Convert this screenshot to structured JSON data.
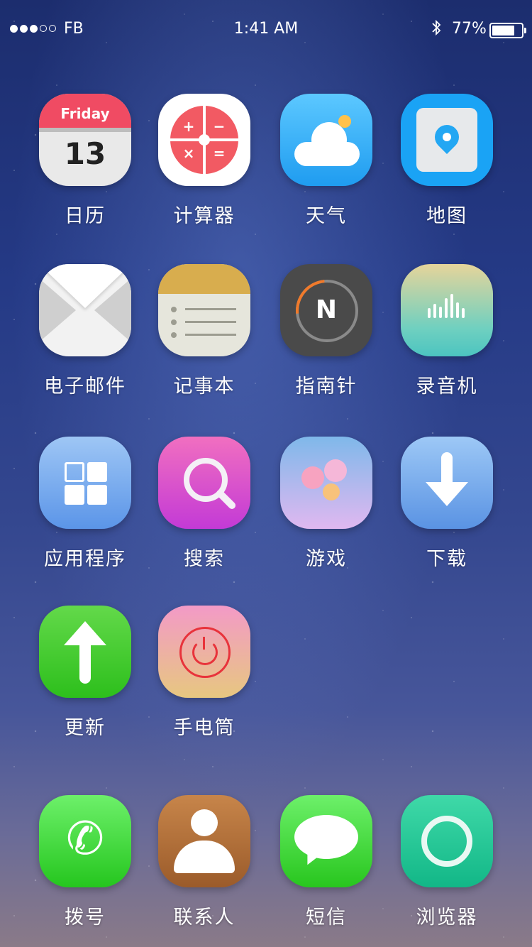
{
  "status_bar": {
    "carrier": "FB",
    "time": "1:41 AM",
    "battery_percent": "77%",
    "battery_level": 0.77,
    "signal_bars_filled": 3,
    "signal_bars_total": 5
  },
  "apps": [
    {
      "label": "日历",
      "day_name": "Friday",
      "day_number": "13"
    },
    {
      "label": "计算器",
      "symbols": [
        "+",
        "−",
        "×",
        "="
      ]
    },
    {
      "label": "天气"
    },
    {
      "label": "地图"
    },
    {
      "label": "电子邮件"
    },
    {
      "label": "记事本"
    },
    {
      "label": "指南针",
      "letter": "N"
    },
    {
      "label": "录音机"
    },
    {
      "label": "应用程序"
    },
    {
      "label": "搜索"
    },
    {
      "label": "游戏"
    },
    {
      "label": "下载"
    },
    {
      "label": "更新"
    },
    {
      "label": "手电筒"
    }
  ],
  "dock": [
    {
      "label": "拨号",
      "glyph": "✆"
    },
    {
      "label": "联系人"
    },
    {
      "label": "短信"
    },
    {
      "label": "浏览器"
    }
  ],
  "colors": {
    "calendar_red": "#f04b63",
    "calculator_red": "#f25a63",
    "weather_blue": "#1f9cf0",
    "update_green": "#2dbf1c",
    "browser_green": "#12b787"
  }
}
